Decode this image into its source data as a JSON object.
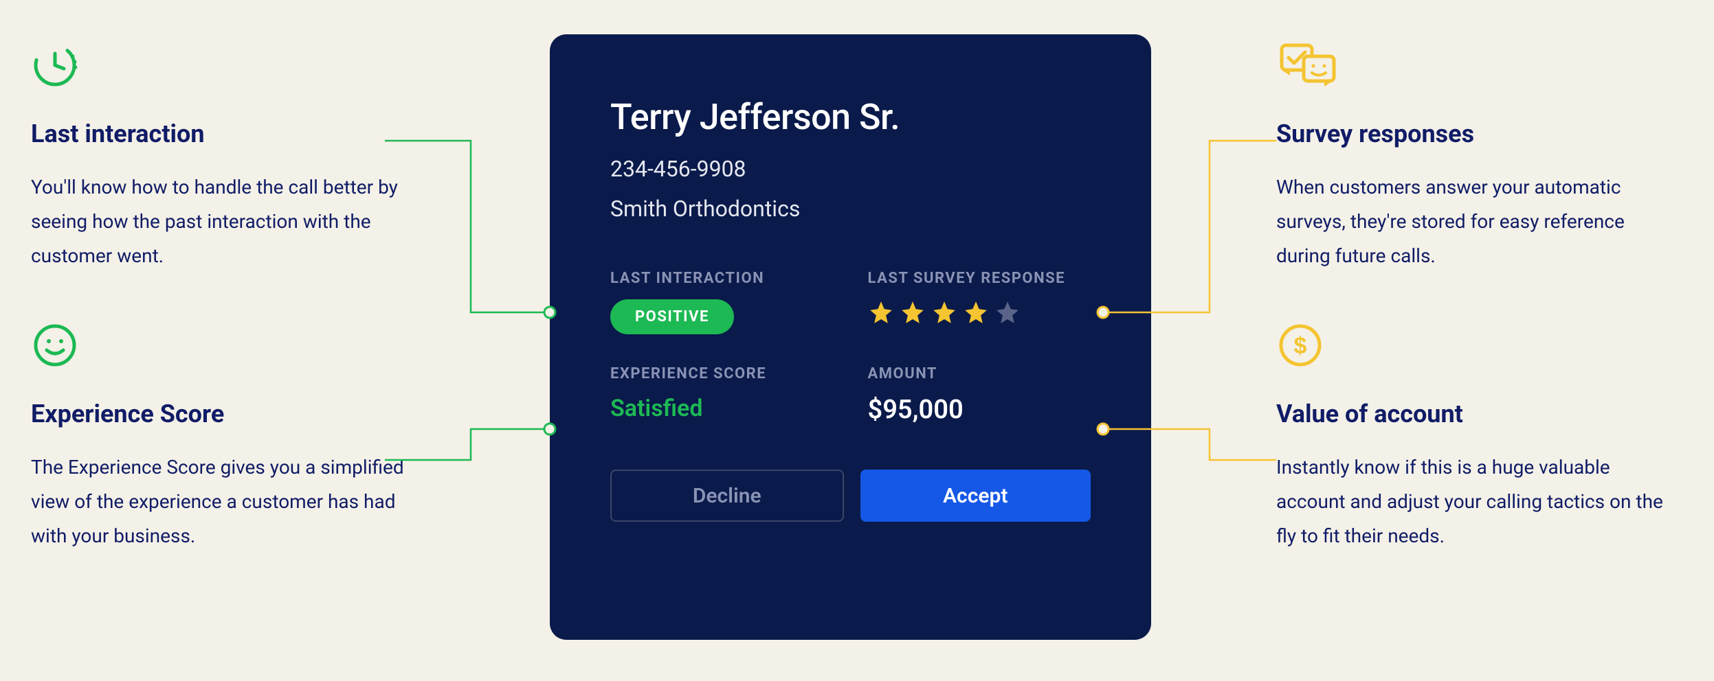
{
  "left": {
    "feature1": {
      "title": "Last interaction",
      "desc": "You'll know how to handle the call better by seeing how the past interaction with the customer went."
    },
    "feature2": {
      "title": "Experience Score",
      "desc": "The Experience Score gives you a simplified view of the experience a customer has had with your business."
    }
  },
  "right": {
    "feature1": {
      "title": "Survey responses",
      "desc": "When customers answer your automatic surveys, they're stored for easy reference during future calls."
    },
    "feature2": {
      "title": "Value of account",
      "desc": "Instantly know if this is a huge valuable account and adjust your calling tactics on the fly to fit their needs."
    }
  },
  "card": {
    "name": "Terry Jefferson Sr.",
    "phone": "234-456-9908",
    "company": "Smith Orthodontics",
    "labels": {
      "last_interaction": "LAST INTERACTION",
      "last_survey": "LAST SURVEY RESPONSE",
      "experience_score": "EXPERIENCE SCORE",
      "amount": "AMOUNT"
    },
    "interaction_badge": "POSITIVE",
    "survey_stars": 4,
    "survey_stars_max": 5,
    "experience_score": "Satisfied",
    "amount": "$95,000",
    "buttons": {
      "decline": "Decline",
      "accept": "Accept"
    }
  },
  "colors": {
    "green": "#1db954",
    "yellow": "#f4c431",
    "navy": "#101c66"
  }
}
